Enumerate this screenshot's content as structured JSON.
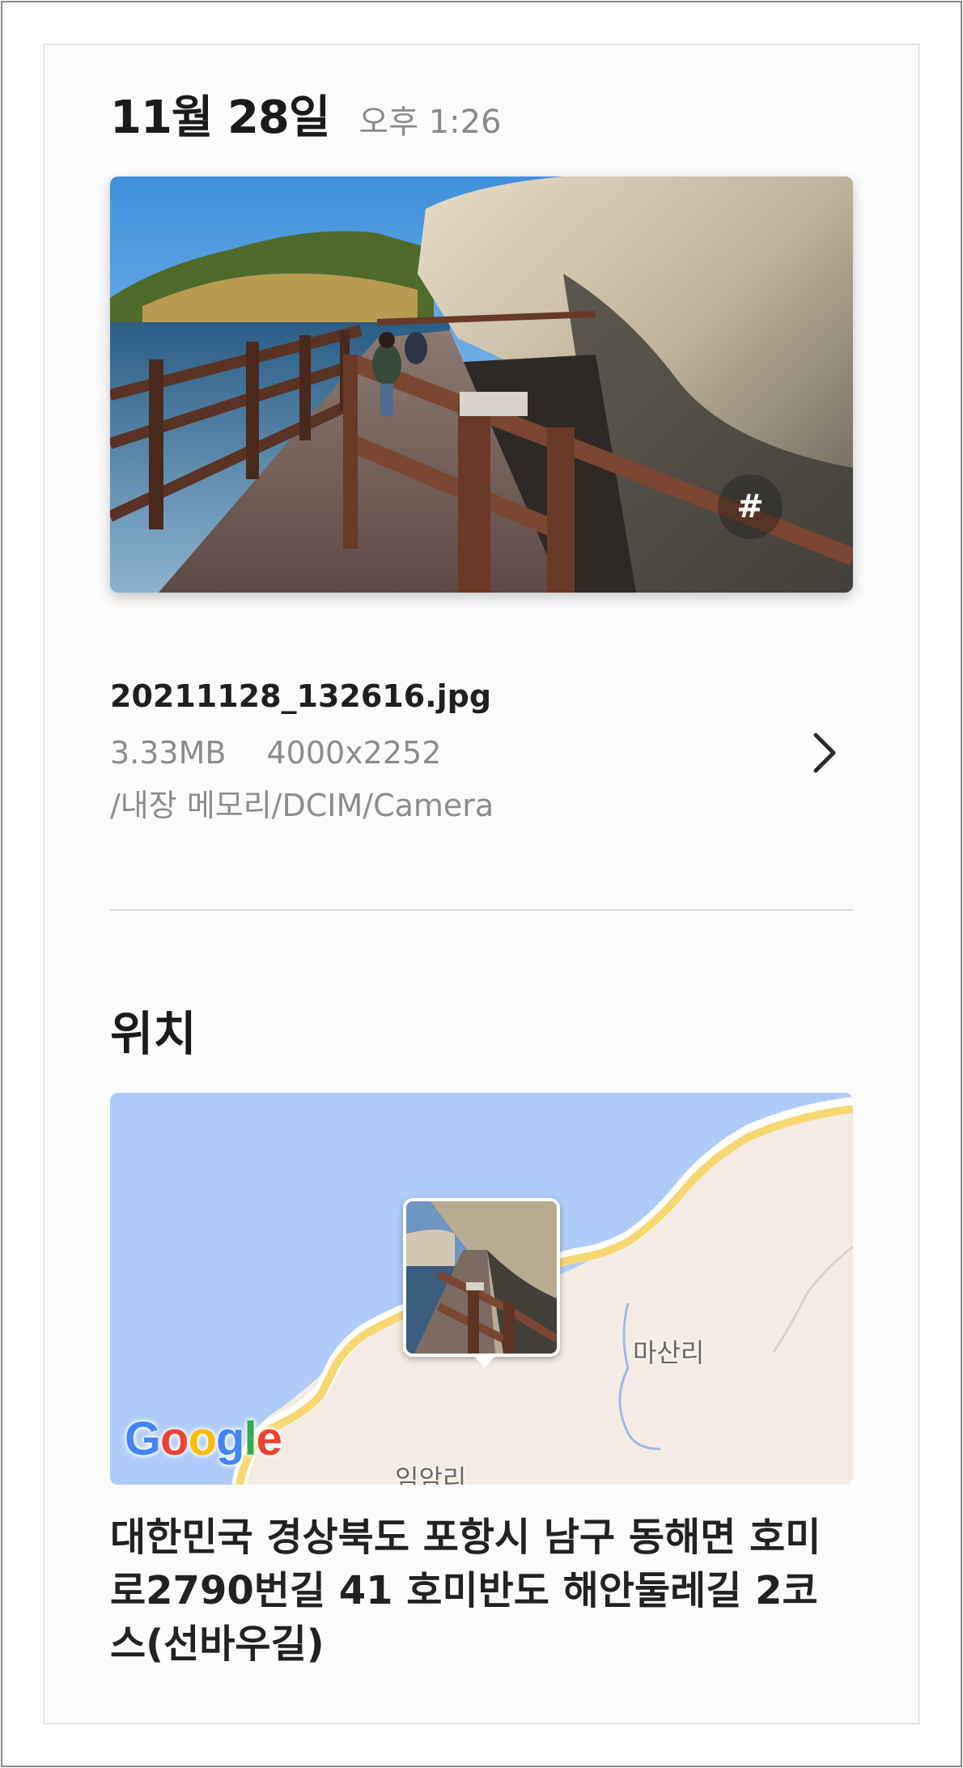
{
  "header": {
    "date": "11월 28일",
    "time": "오후 1:26"
  },
  "photo": {
    "tag_button_label": "#"
  },
  "file": {
    "name": "20211128_132616.jpg",
    "size": "3.33MB",
    "resolution": "4000x2252",
    "path": "/내장 메모리/DCIM/Camera"
  },
  "location": {
    "title": "위치",
    "map": {
      "place_labels": [
        "마산리",
        "임암리"
      ],
      "logo_letters": [
        "G",
        "o",
        "o",
        "g",
        "l",
        "e"
      ],
      "logo_colors": [
        "#4285F4",
        "#EA4335",
        "#FBBC05",
        "#4285F4",
        "#34A853",
        "#EA4335"
      ]
    },
    "address": "대한민국 경상북도 포항시 남구 동해면 호미로2790번길 41 호미반도 해안둘레길 2코스(선바우길)"
  },
  "icons": {
    "chevron": "chevron-right-icon",
    "tag": "hashtag-icon"
  }
}
